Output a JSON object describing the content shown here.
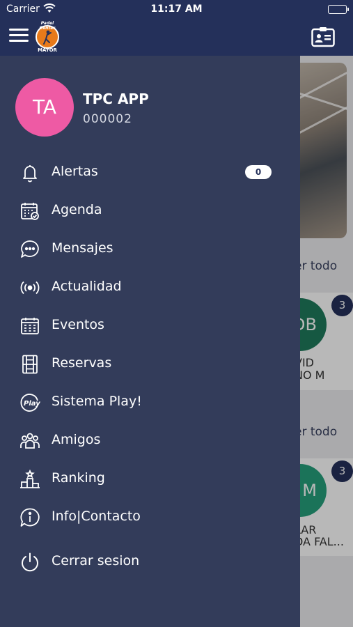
{
  "status_bar": {
    "carrier": "Carrier",
    "time": "11:17 AM"
  },
  "app_bar": {
    "logo_top_text": "Padel Center",
    "logo_bottom_text": "MAYOR",
    "menu_icon": "hamburger-icon",
    "right_icon": "id-card-icon"
  },
  "profile": {
    "initials": "TA",
    "name": "TPC APP",
    "id": "000002",
    "avatar_color": "#ee5aa4"
  },
  "menu": {
    "items": [
      {
        "label": "Alertas",
        "icon": "bell-icon",
        "badge": "0"
      },
      {
        "label": "Agenda",
        "icon": "calendar-check-icon"
      },
      {
        "label": "Mensajes",
        "icon": "chat-bubble-icon"
      },
      {
        "label": "Actualidad",
        "icon": "broadcast-icon"
      },
      {
        "label": "Eventos",
        "icon": "calendar-grid-icon"
      },
      {
        "label": "Reservas",
        "icon": "court-icon"
      },
      {
        "label": "Sistema Play!",
        "icon": "play-badge-icon"
      },
      {
        "label": "Amigos",
        "icon": "friends-icon"
      },
      {
        "label": "Ranking",
        "icon": "podium-icon"
      },
      {
        "label": "Info|Contacto",
        "icon": "info-icon"
      },
      {
        "label": "Cerrar sesion",
        "icon": "power-icon"
      }
    ]
  },
  "background": {
    "see_all_1": "er todo",
    "see_all_2": "er todo",
    "card1": {
      "initials": "DB",
      "badge": "3",
      "name_line1": "VID",
      "name_line2": "NO M",
      "avatar_color": "#1f7a5c"
    },
    "card2": {
      "initials": "M",
      "badge": "3",
      "name_line1": "LAR",
      "name_line2": "DA FAL...",
      "avatar_color": "#26a07c"
    }
  },
  "colors": {
    "navy": "#24305a",
    "drawer": "#333c5a",
    "accent_orange": "#e87a1a"
  }
}
